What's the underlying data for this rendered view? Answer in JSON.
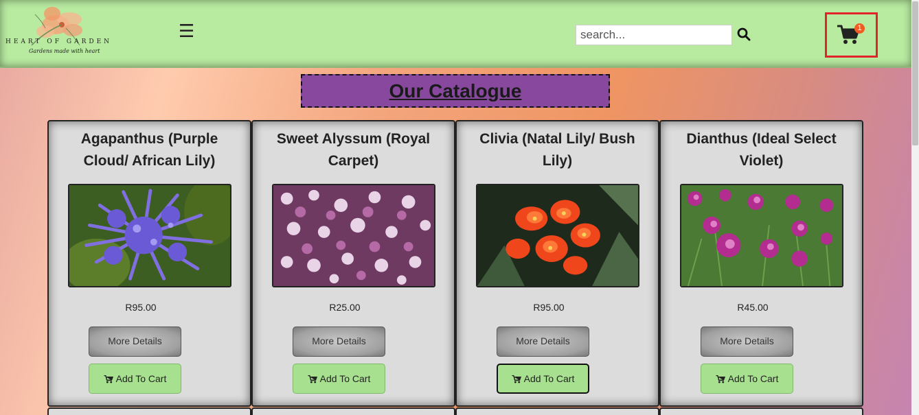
{
  "header": {
    "logo_text": "HEART OF GARDEN",
    "logo_tagline": "Gardens made with heart",
    "menu_icon": "hamburger-icon",
    "search_placeholder": "search...",
    "search_icon": "search-icon",
    "cart_icon": "cart-icon",
    "cart_count": "1",
    "cart_highlight_color": "#e2232a"
  },
  "catalogue": {
    "title": "Our Catalogue",
    "title_bg": "#87489e",
    "more_details_label": "More Details",
    "add_to_cart_label": "Add To Cart",
    "products": [
      {
        "name": "Agapanthus (Purple Cloud/ African Lily)",
        "price": "R95.00"
      },
      {
        "name": "Sweet Alyssum (Royal Carpet)",
        "price": "R25.00"
      },
      {
        "name": "Clivia (Natal Lily/ Bush Lily)",
        "price": "R95.00"
      },
      {
        "name": "Dianthus (Ideal Select Violet)",
        "price": "R45.00"
      }
    ]
  },
  "colors": {
    "header_bg": "#b8eaa0",
    "card_bg": "#dcdcdc",
    "add_to_cart_bg": "#a7e08f",
    "badge": "#f25b22"
  }
}
